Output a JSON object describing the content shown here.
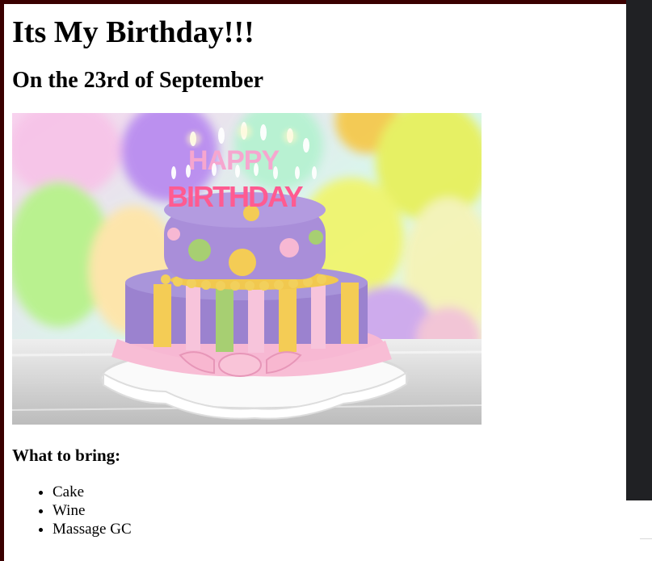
{
  "page": {
    "title": "Its My Birthday!!!",
    "subtitle": "On the 23rd of September"
  },
  "image": {
    "description_icon": "birthday-cake-image",
    "candle_text_top": "HAPPY",
    "candle_text_bottom": "BIRTHDAY",
    "colors": {
      "cake_purple": "#9b82cf",
      "cake_yellow": "#f4cc55",
      "cake_green": "#a7cf72",
      "cake_pink": "#f7b8d3",
      "balloon_yellow": "#e7f05d",
      "balloon_purple": "#b98cf0",
      "balloon_green": "#b7f28b"
    }
  },
  "bring": {
    "heading": "What to bring:",
    "items": [
      {
        "label": "Cake"
      },
      {
        "label": "Wine"
      },
      {
        "label": "Massage GC"
      }
    ]
  },
  "colors": {
    "frame": "#3a0000",
    "scrollbar": "#202124",
    "text": "#000000",
    "background": "#ffffff"
  }
}
